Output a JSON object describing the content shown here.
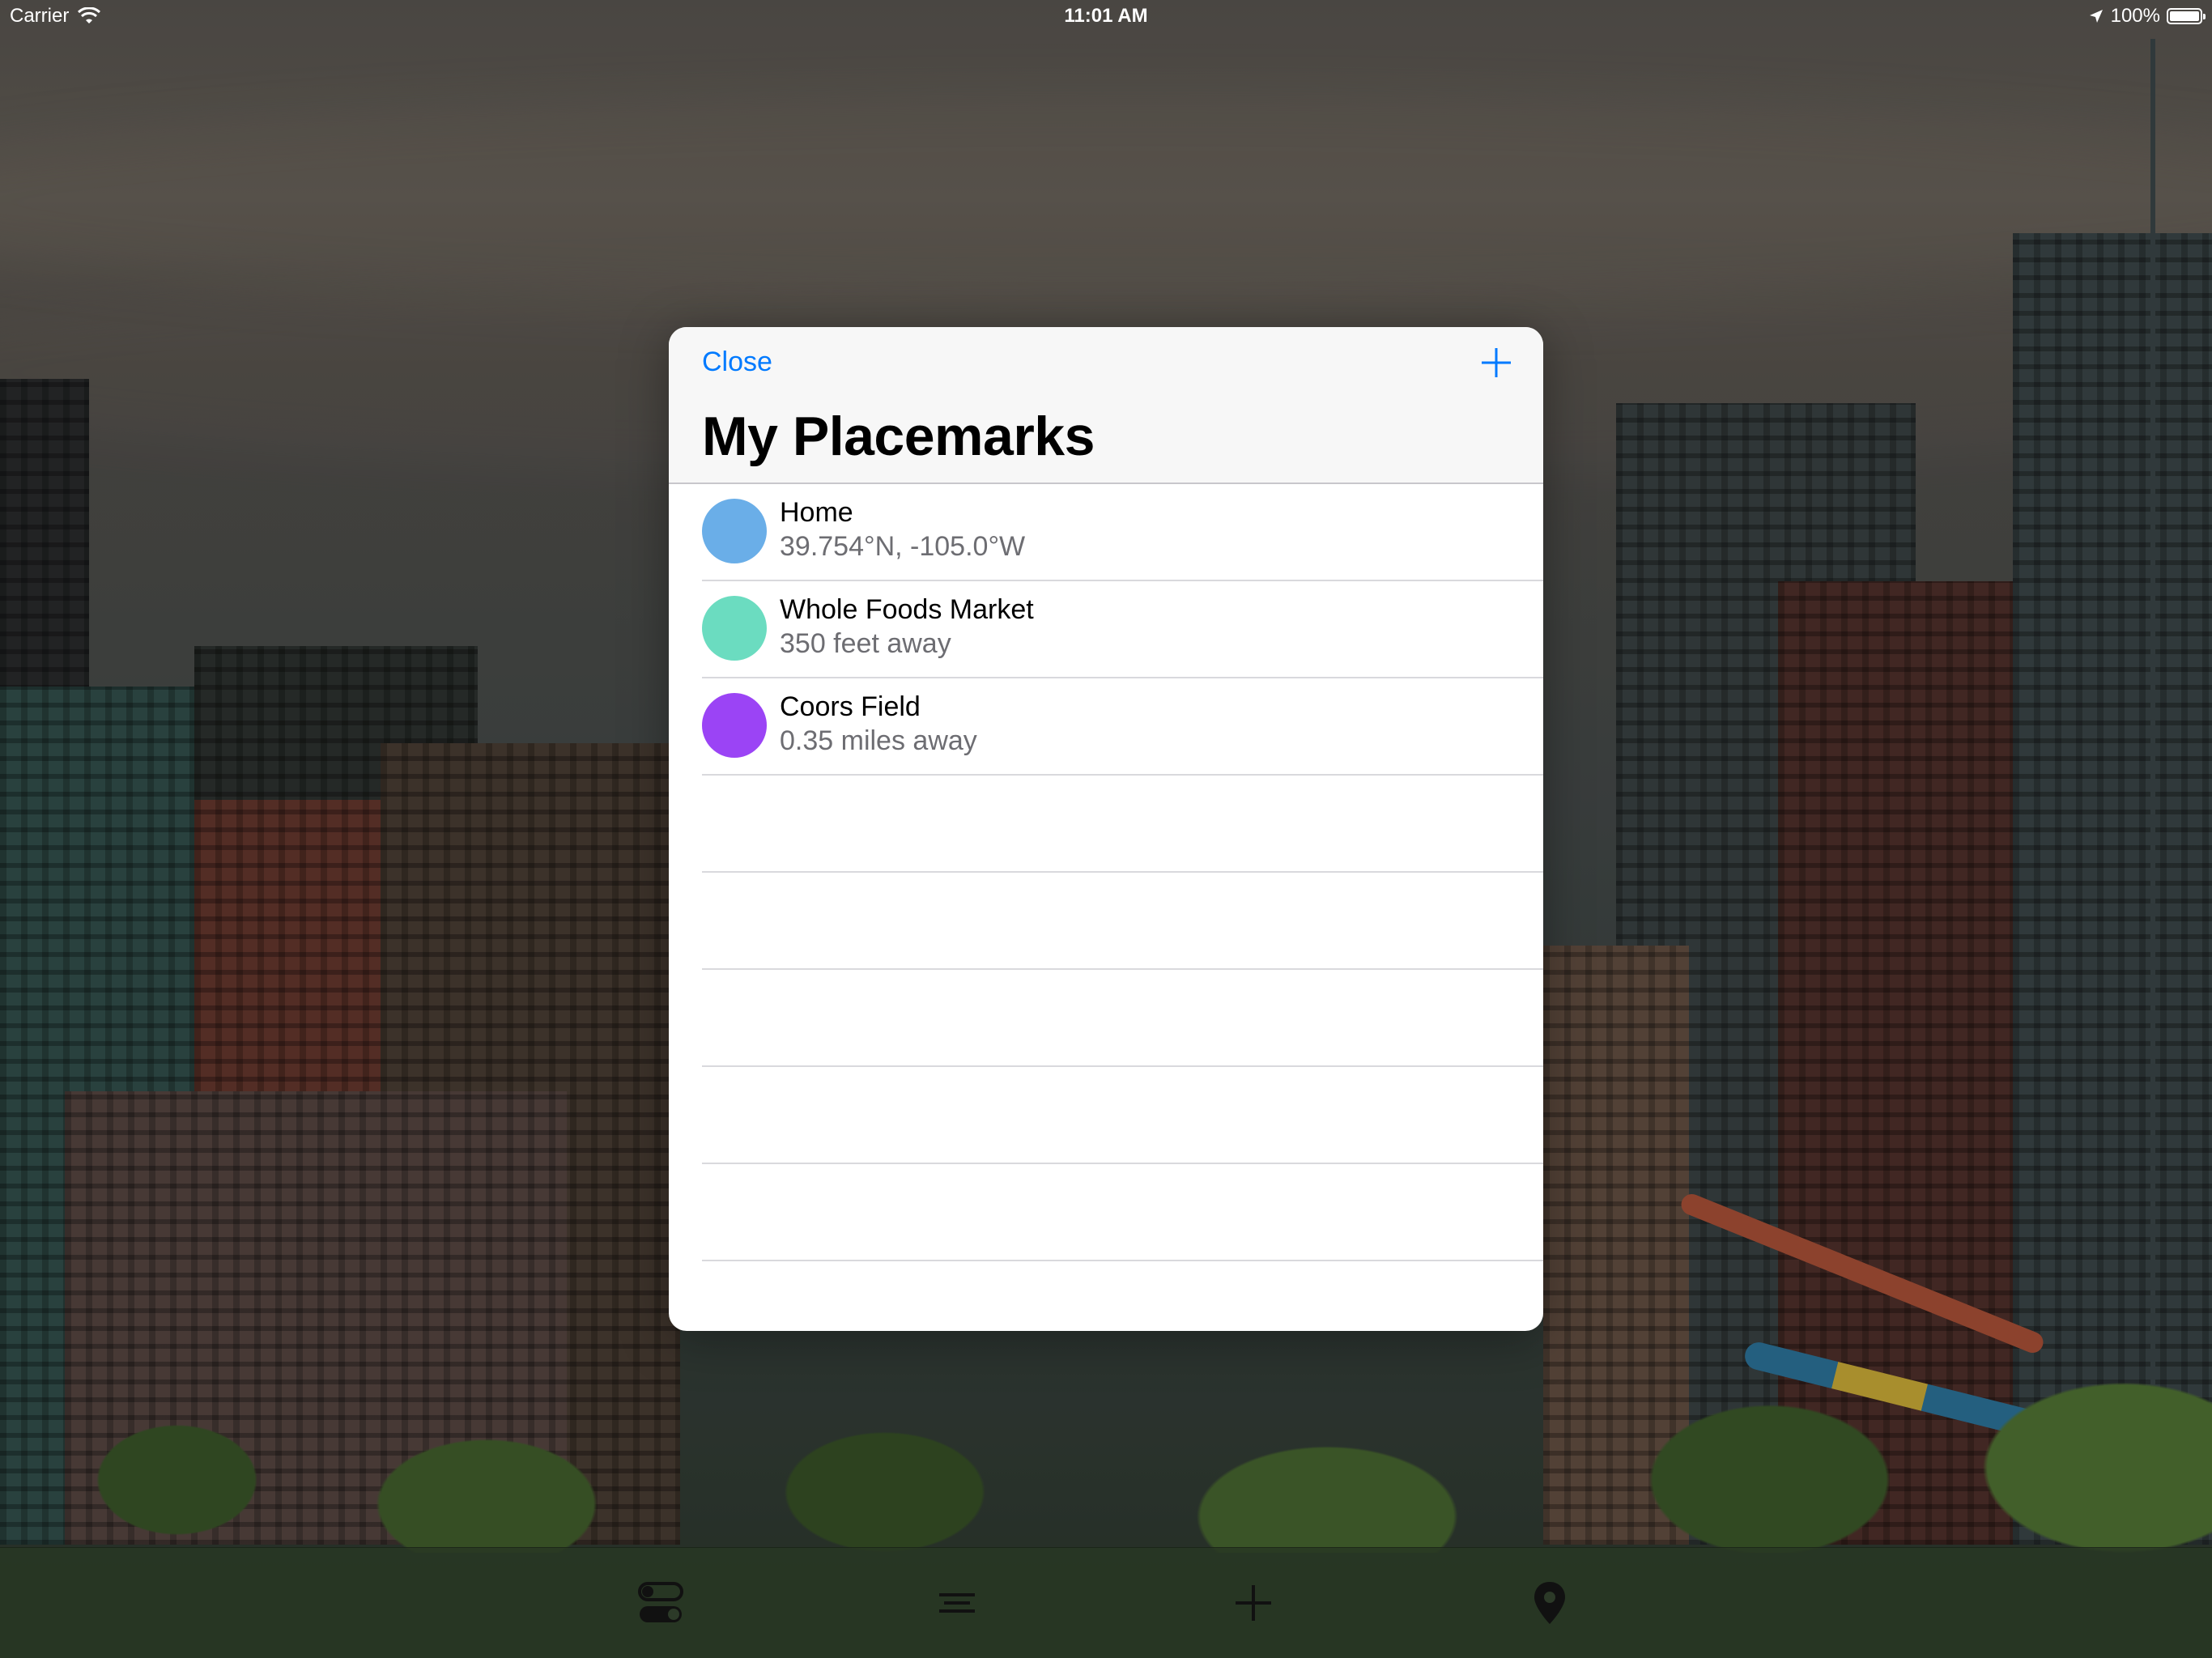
{
  "status_bar": {
    "carrier": "Carrier",
    "time": "11:01 AM",
    "battery": "100%"
  },
  "sheet": {
    "close_label": "Close",
    "title": "My Placemarks",
    "items": [
      {
        "title": "Home",
        "subtitle": "39.754°N, -105.0°W",
        "color": "#6aaee8"
      },
      {
        "title": "Whole Foods Market",
        "subtitle": "350 feet away",
        "color": "#6bdcc0"
      },
      {
        "title": "Coors Field",
        "subtitle": "0.35 miles away",
        "color": "#9b44f5"
      }
    ]
  },
  "tab_bar": {
    "icons": [
      "toggle-icon",
      "list-icon",
      "plus-icon",
      "location-pin-icon"
    ]
  },
  "colors": {
    "accent": "#007aff"
  }
}
